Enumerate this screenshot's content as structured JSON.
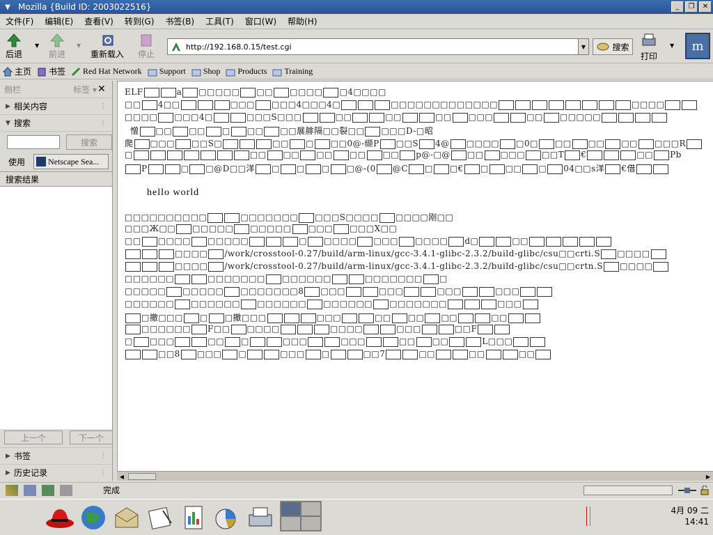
{
  "window": {
    "title": "Mozilla {Build ID: 2003022516}"
  },
  "menu": [
    "文件(F)",
    "编辑(E)",
    "查看(V)",
    "转到(G)",
    "书签(B)",
    "工具(T)",
    "窗口(W)",
    "帮助(H)"
  ],
  "nav": {
    "back": "后退",
    "forward": "前进",
    "reload": "重新载入",
    "stop": "停止",
    "url": "http://192.168.0.15/test.cgi",
    "search": "搜索",
    "print": "打印"
  },
  "bookmarks": [
    "主页",
    "书签",
    "Red Hat Network",
    "Support",
    "Shop",
    "Products",
    "Training"
  ],
  "sidebar": {
    "title": "侧栏",
    "tabs": "标签",
    "related": "相关内容",
    "search": "搜索",
    "search_button": "搜索",
    "use_label": "使用",
    "engine": "Netscape Sea...",
    "results_label": "搜索结果",
    "prev": "上一个",
    "next": "下一个",
    "bookmarks": "书签",
    "history": "历史记录"
  },
  "content": {
    "hello": "hello world",
    "path1": "/work/crosstool-0.27/build/arm-linux/gcc-3.4.1-glibc-2.3.2/build-glibc/csu",
    "path1_suffix": "crti.S",
    "path2": "/work/crosstool-0.27/build/arm-linux/gcc-3.4.1-glibc-2.3.2/build-glibc/csu",
    "path2_suffix": "crtn.S"
  },
  "status": {
    "text": "完成"
  },
  "clock": {
    "date": "4月 09 二",
    "time": "14:41"
  },
  "colors": {
    "titlebar": "#2a5596",
    "accent": "#3a6cb0"
  }
}
